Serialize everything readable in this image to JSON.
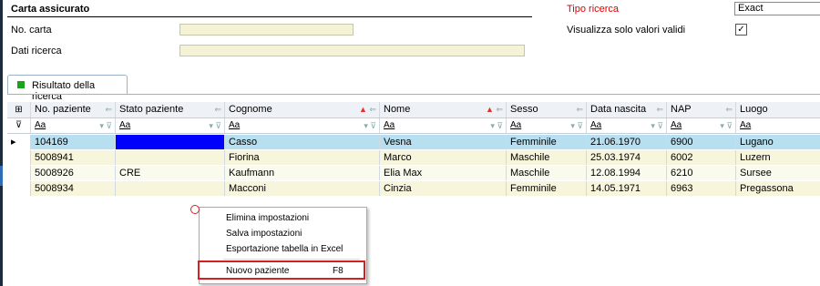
{
  "header": {
    "section_title": "Carta assicurato",
    "card_label": "No. carta",
    "search_data_label": "Dati ricerca",
    "card_value": "",
    "search_data_value": ""
  },
  "search_options": {
    "type_label": "Tipo ricerca",
    "type_value": "Exact",
    "valid_only_label": "Visualizza solo valori validi",
    "valid_only_checked": "✓"
  },
  "tab": {
    "label": "Risultato della ricerca"
  },
  "table": {
    "columns": [
      "No. paziente",
      "Stato paziente",
      "Cognome",
      "Nome",
      "Sesso",
      "Data nascita",
      "NAP",
      "Luogo"
    ],
    "filter_placeholder": "Aa",
    "rows": [
      {
        "no": "104169",
        "stato": "",
        "cognome": "Casso",
        "nome": "Vesna",
        "sesso": "Femminile",
        "data": "21.06.1970",
        "nap": "6900",
        "luogo": "Lugano"
      },
      {
        "no": "5008941",
        "stato": "",
        "cognome": "Fiorina",
        "nome": "Marco",
        "sesso": "Maschile",
        "data": "25.03.1974",
        "nap": "6002",
        "luogo": "Luzern"
      },
      {
        "no": "5008926",
        "stato": "CRE",
        "cognome": "Kaufmann",
        "nome": "Elia Max",
        "sesso": "Maschile",
        "data": "12.08.1994",
        "nap": "6210",
        "luogo": "Sursee"
      },
      {
        "no": "5008934",
        "stato": "",
        "cognome": "Macconi",
        "nome": "Cinzia",
        "sesso": "Femminile",
        "data": "14.05.1971",
        "nap": "6963",
        "luogo": "Pregassona"
      }
    ]
  },
  "context_menu": {
    "items": [
      "Elimina impostazioni",
      "Salva impostazioni",
      "Esportazione tabella in Excel",
      "Nuovo paziente"
    ],
    "shortcut": "F8"
  },
  "colors": {
    "selected_row": "#b8dfef",
    "highlight_cell": "#0000ff",
    "accent_red": "#e00000",
    "annotation_red": "#d42020"
  }
}
